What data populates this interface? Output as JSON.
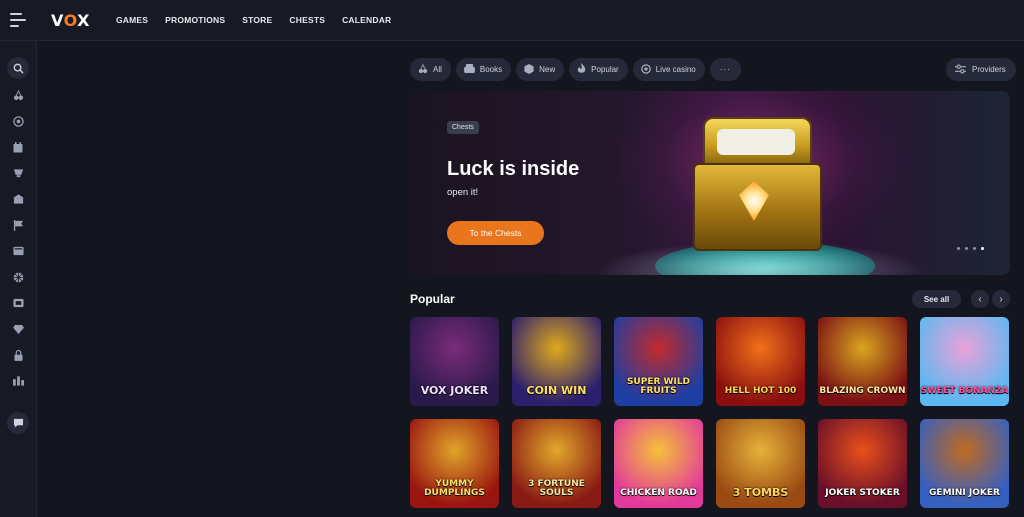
{
  "header": {
    "logo": {
      "part1": "V",
      "part2": "O",
      "part3": "X"
    },
    "nav": [
      "GAMES",
      "PROMOTIONS",
      "STORE",
      "CHESTS",
      "CALENDAR"
    ]
  },
  "sidebar": {
    "icons": [
      "search-icon",
      "cherries-icon",
      "roulette-icon",
      "calendar-icon",
      "trophy-icon",
      "store-icon",
      "flag-icon",
      "news-icon",
      "wheel-icon",
      "tournament-icon",
      "diamond-icon",
      "lock-icon",
      "stats-icon",
      "chat-icon"
    ]
  },
  "filters": [
    {
      "icon": "cherries-icon",
      "label": "All"
    },
    {
      "icon": "books-icon",
      "label": "Books"
    },
    {
      "icon": "cube-icon",
      "label": "New"
    },
    {
      "icon": "fire-icon",
      "label": "Popular"
    },
    {
      "icon": "live-casino-icon",
      "label": "Live casino"
    }
  ],
  "more_label": "···",
  "providers_label": "Providers",
  "banner": {
    "tag": "Chests",
    "title": "Luck is inside",
    "subtitle": "open it!",
    "button": "To the Chests",
    "slides": 4,
    "active_slide": 4
  },
  "popular": {
    "title": "Popular",
    "see_all": "See all",
    "prev": "‹",
    "next": "›",
    "games": [
      {
        "name": "VOX JOKER",
        "colors": [
          "#2a1a4a",
          "#7a2b7a"
        ],
        "text": "#f0e0ff"
      },
      {
        "name": "COIN WIN",
        "colors": [
          "#2b1f6e",
          "#e0a91c"
        ],
        "text": "#ffe066"
      },
      {
        "name": "SUPER WILD FRUITS",
        "colors": [
          "#1d3ea3",
          "#c32a2a"
        ],
        "text": "#ffe066"
      },
      {
        "name": "HELL HOT 100",
        "colors": [
          "#8a1010",
          "#f2701a"
        ],
        "text": "#ffd45a"
      },
      {
        "name": "BLAZING CROWN",
        "colors": [
          "#7a0f14",
          "#d9a51f"
        ],
        "text": "#ffe6a0"
      },
      {
        "name": "SWEET BONANZA",
        "colors": [
          "#5cb8f0",
          "#e9a2d8"
        ],
        "text": "#ff4fa0"
      },
      {
        "name": "YUMMY DUMPLINGS",
        "colors": [
          "#9a1510",
          "#e0a52a"
        ],
        "text": "#ffe066"
      },
      {
        "name": "3 FORTUNE SOULS",
        "colors": [
          "#8a1a14",
          "#e2a82a"
        ],
        "text": "#ffe8a0"
      },
      {
        "name": "CHICKEN ROAD",
        "colors": [
          "#e23a9a",
          "#f5c13a"
        ],
        "text": "#ffffff"
      },
      {
        "name": "3 TOMBS",
        "colors": [
          "#9a4a12",
          "#e6b23a"
        ],
        "text": "#ffd45a"
      },
      {
        "name": "JOKER STOKER",
        "colors": [
          "#6a0f2a",
          "#e9501a"
        ],
        "text": "#ffffff"
      },
      {
        "name": "GEMINI JOKER",
        "colors": [
          "#3560c0",
          "#c06a20"
        ],
        "text": "#ffffff"
      }
    ]
  }
}
